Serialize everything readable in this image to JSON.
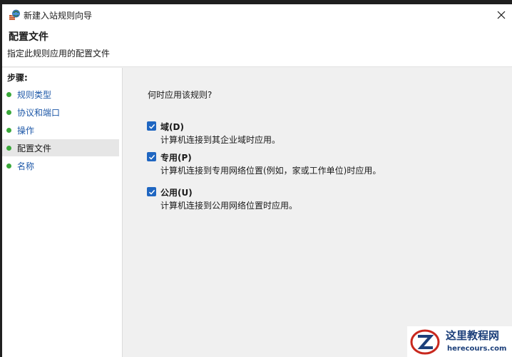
{
  "window": {
    "title": "新建入站规则向导",
    "icon": "firewall-rule-icon"
  },
  "header": {
    "title": "配置文件",
    "subtitle": "指定此规则应用的配置文件"
  },
  "sidebar": {
    "heading": "步骤:",
    "items": [
      {
        "label": "规则类型",
        "active": false
      },
      {
        "label": "协议和端口",
        "active": false
      },
      {
        "label": "操作",
        "active": false
      },
      {
        "label": "配置文件",
        "active": true
      },
      {
        "label": "名称",
        "active": false
      }
    ]
  },
  "main": {
    "question": "何时应用该规则?",
    "options": [
      {
        "title": "域(D)",
        "description": "计算机连接到其企业域时应用。",
        "checked": true
      },
      {
        "title": "专用(P)",
        "description": "计算机连接到专用网络位置(例如，家或工作单位)时应用。",
        "checked": true
      },
      {
        "title": "公用(U)",
        "description": "计算机连接到公用网络位置时应用。",
        "checked": true
      }
    ]
  },
  "watermark": {
    "name": "这里教程网",
    "url": "herecours.com"
  },
  "colors": {
    "checkbox": "#1f66c1",
    "link": "#1e58a8",
    "step_dot": "#3aa83a",
    "watermark_text": "#1c3f7a"
  }
}
